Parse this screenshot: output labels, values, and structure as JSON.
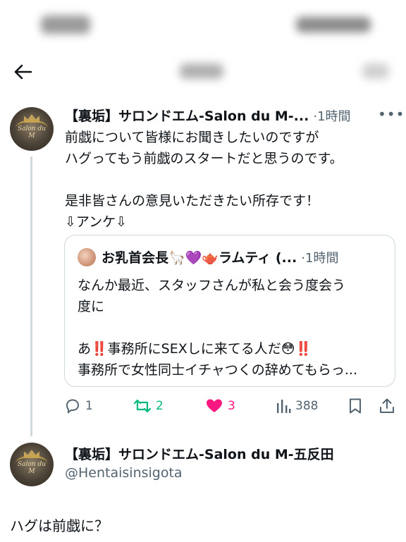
{
  "top_bar": {
    "back_icon": "back-arrow-icon"
  },
  "tweet": {
    "author_name": "【裏垢】サロンドエム-Salon du M-...",
    "time": "·1時間",
    "text_line1": "前戯について皆様にお聞きしたいのですが",
    "text_line2": "ハグってもう前戯のスタートだと思うのです。",
    "text_line3": "是非皆さんの意見いただきたい所存です！",
    "text_line4": "⇩アンケ⇩"
  },
  "quote": {
    "author_name": "お乳首会長🦙💜🫖ラムティ (...",
    "time": "·1時間",
    "text_line1": "なんか最近、スタッフさんが私と会う度会う",
    "text_line2": "度に",
    "text_line3": "あ‼️事務所にSEXしに来てる人だ😳‼️",
    "text_line4": "事務所で女性同士イチャつくの辞めてもらっ..."
  },
  "actions": {
    "reply_count": "1",
    "retweet_count": "2",
    "like_count": "3",
    "views_count": "388"
  },
  "reply": {
    "author_name": "【裏垢】サロンドエム-Salon du M-五反田",
    "handle": "@Hentaisinsigota",
    "text": "ハグは前戯に？"
  },
  "colors": {
    "retweet": "#00ba7c",
    "like": "#f91880",
    "muted": "#536471",
    "thread_line": "#cfd9de"
  }
}
